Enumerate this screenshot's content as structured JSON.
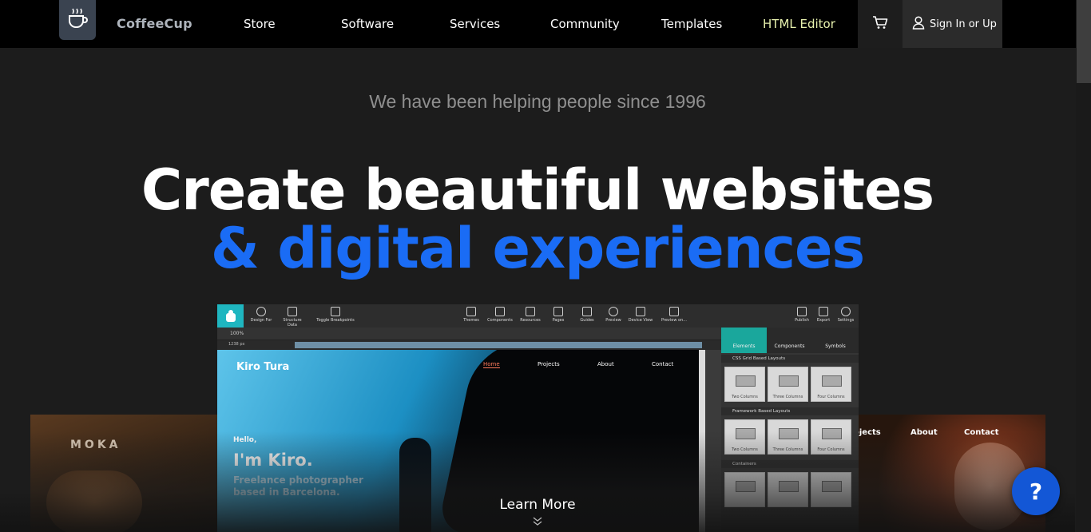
{
  "nav": {
    "brand": "CoffeeCup",
    "items": [
      {
        "label": "Store"
      },
      {
        "label": "Software"
      },
      {
        "label": "Services"
      },
      {
        "label": "Community"
      },
      {
        "label": "Templates"
      },
      {
        "label": "HTML Editor"
      }
    ],
    "signin_label": "Sign In or Up",
    "icons": {
      "logo": "coffee-cup-icon",
      "cart": "cart-icon",
      "user": "user-icon"
    },
    "accent_color": "#e7f1ad"
  },
  "hero": {
    "tagline": "We have been helping people since 1996",
    "headline_line1": "Create beautiful websites",
    "headline_line2": "& digital experiences",
    "headline_accent_color": "#1a6cf5"
  },
  "cards": {
    "left_brand": "MOKA",
    "right_links": [
      "ojects",
      "About",
      "Contact"
    ]
  },
  "app": {
    "toolbar_left": [
      {
        "label": "Design For"
      },
      {
        "label": "Structure Data"
      },
      {
        "label": "Toggle Breakpoints"
      }
    ],
    "toolbar_center": [
      {
        "label": "Themes"
      },
      {
        "label": "Components"
      },
      {
        "label": "Resources"
      },
      {
        "label": "Pages"
      },
      {
        "label": "Guides"
      },
      {
        "label": "Preview"
      },
      {
        "label": "Device View"
      },
      {
        "label": "Preview on..."
      }
    ],
    "toolbar_right": [
      {
        "label": "Publish"
      },
      {
        "label": "Export"
      },
      {
        "label": "Settings"
      }
    ],
    "zoom": "100%",
    "width": "1238 px",
    "canvas": {
      "site_title": "Kiro Tura",
      "nav": [
        "Home",
        "Projects",
        "About",
        "Contact"
      ],
      "hello": "Hello,",
      "intro": "I'm Kiro.",
      "sub_line1": "Freelance photographer",
      "sub_line2": "based in Barcelona."
    },
    "panel": {
      "tabs": [
        "Elements",
        "Components",
        "Symbols"
      ],
      "section1": "CSS Grid Based Layouts",
      "section1_tiles": [
        "Two Columns",
        "Three Columns",
        "Four Columns"
      ],
      "section2": "Framework Based Layouts",
      "section2_tiles": [
        "Two Columns",
        "Three Columns",
        "Four Columns"
      ],
      "section3": "Containers"
    }
  },
  "footer": {
    "learn_more": "Learn More",
    "help": "?"
  }
}
